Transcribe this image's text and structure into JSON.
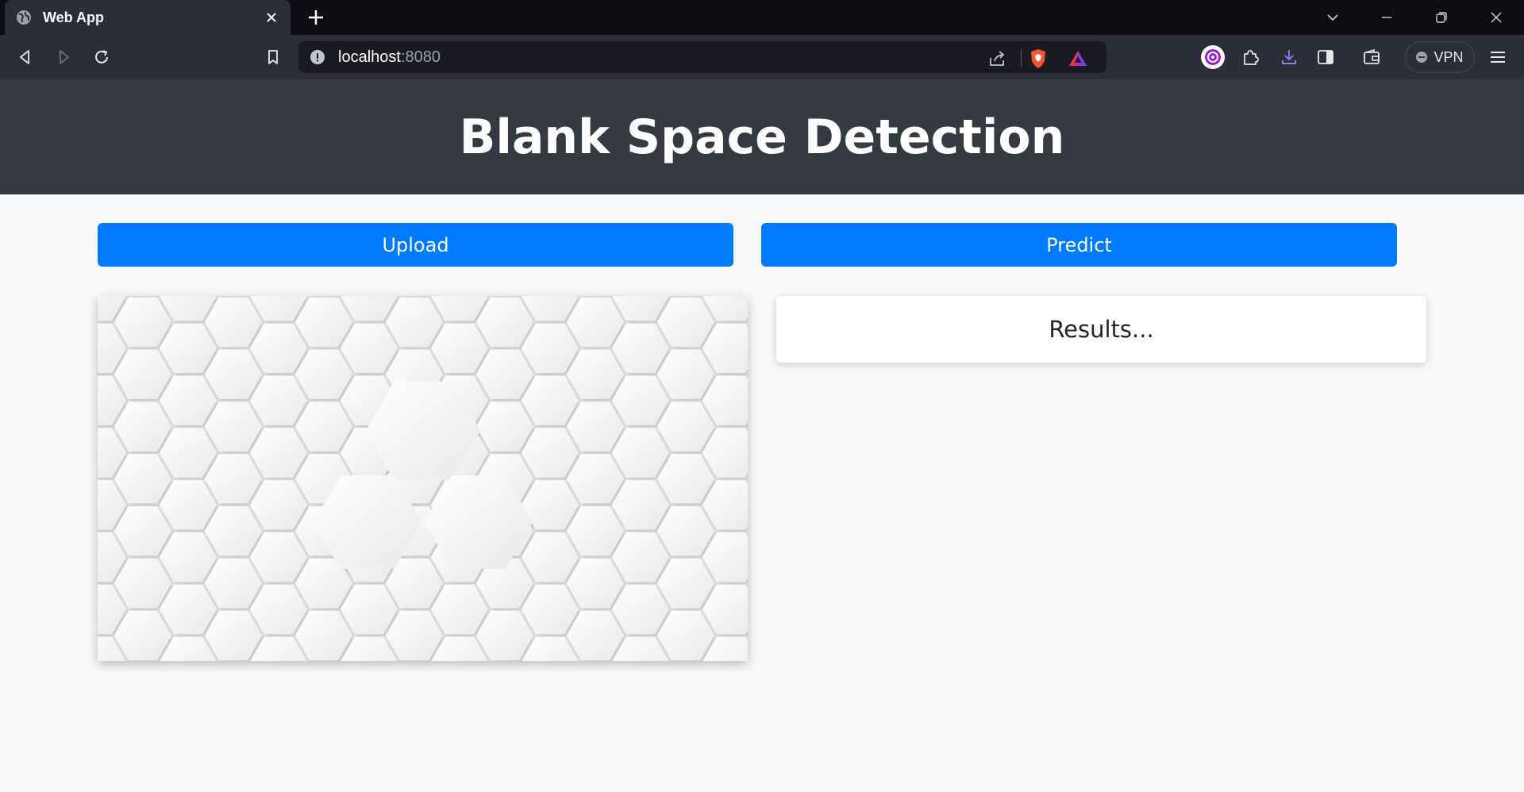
{
  "browser": {
    "tab": {
      "title": "Web App"
    },
    "address": {
      "host": "localhost",
      "port": ":8080"
    },
    "vpn_label": "VPN"
  },
  "page": {
    "title": "Blank Space Detection",
    "upload_label": "Upload",
    "predict_label": "Predict",
    "results_text": "Results..."
  },
  "colors": {
    "header_bg": "#343a40",
    "button_primary": "#007bff",
    "page_bg": "#f8f9fa"
  }
}
